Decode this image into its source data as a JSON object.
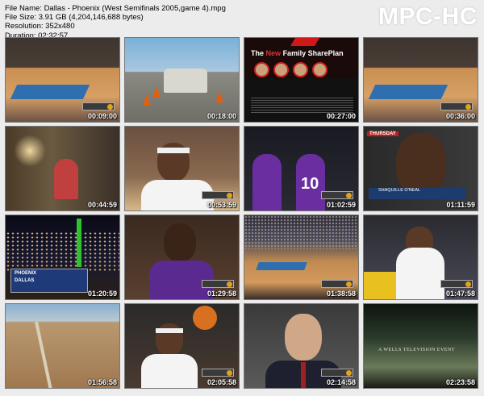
{
  "file_info": {
    "name_line": "File Name: Dallas - Phoenix (West Semifinals 2005,game 4).mpg",
    "size_line": "File Size: 3.91 GB (4,204,146,688 bytes)",
    "resolution_line": "Resolution: 352x480",
    "duration_line": "Duration: 02:32:57"
  },
  "logo": {
    "text": "MPC-HC",
    "color": "#ffffff"
  },
  "thumbnails": [
    {
      "timestamp": "00:09:00",
      "scene": "basketball-court"
    },
    {
      "timestamp": "00:18:00",
      "scene": "car-commercial"
    },
    {
      "timestamp": "00:27:00",
      "scene": "family-shareplan-ad",
      "ad_title_prefix": "The",
      "ad_title_accent": "New",
      "ad_title_rest": "Family SharePlan"
    },
    {
      "timestamp": "00:36:00",
      "scene": "basketball-court"
    },
    {
      "timestamp": "00:44:59",
      "scene": "living-room"
    },
    {
      "timestamp": "00:53:59",
      "scene": "player-headband"
    },
    {
      "timestamp": "01:02:59",
      "scene": "team-huddle",
      "jersey_number": "10"
    },
    {
      "timestamp": "01:11:59",
      "scene": "shaquille-interview",
      "tag": "THURSDAY",
      "lower_third": "SHAQUILLE O'NEAL"
    },
    {
      "timestamp": "01:20:59",
      "scene": "city-night-scoreboard",
      "score_lines": [
        "PHOENIX",
        "DALLAS"
      ]
    },
    {
      "timestamp": "01:29:58",
      "scene": "player-purple-jersey"
    },
    {
      "timestamp": "01:38:58",
      "scene": "arena-wide"
    },
    {
      "timestamp": "01:47:58",
      "scene": "bench-players"
    },
    {
      "timestamp": "01:56:58",
      "scene": "desert-road"
    },
    {
      "timestamp": "02:05:58",
      "scene": "player-with-ball"
    },
    {
      "timestamp": "02:14:58",
      "scene": "coach-closeup"
    },
    {
      "timestamp": "02:23:58",
      "scene": "promo-landscape",
      "caption": "A WELLS TELEVISION EVENT"
    }
  ],
  "colors": {
    "background": "#ececec",
    "court_blue": "#2f6fb0",
    "suns_purple": "#6a2ea0"
  }
}
